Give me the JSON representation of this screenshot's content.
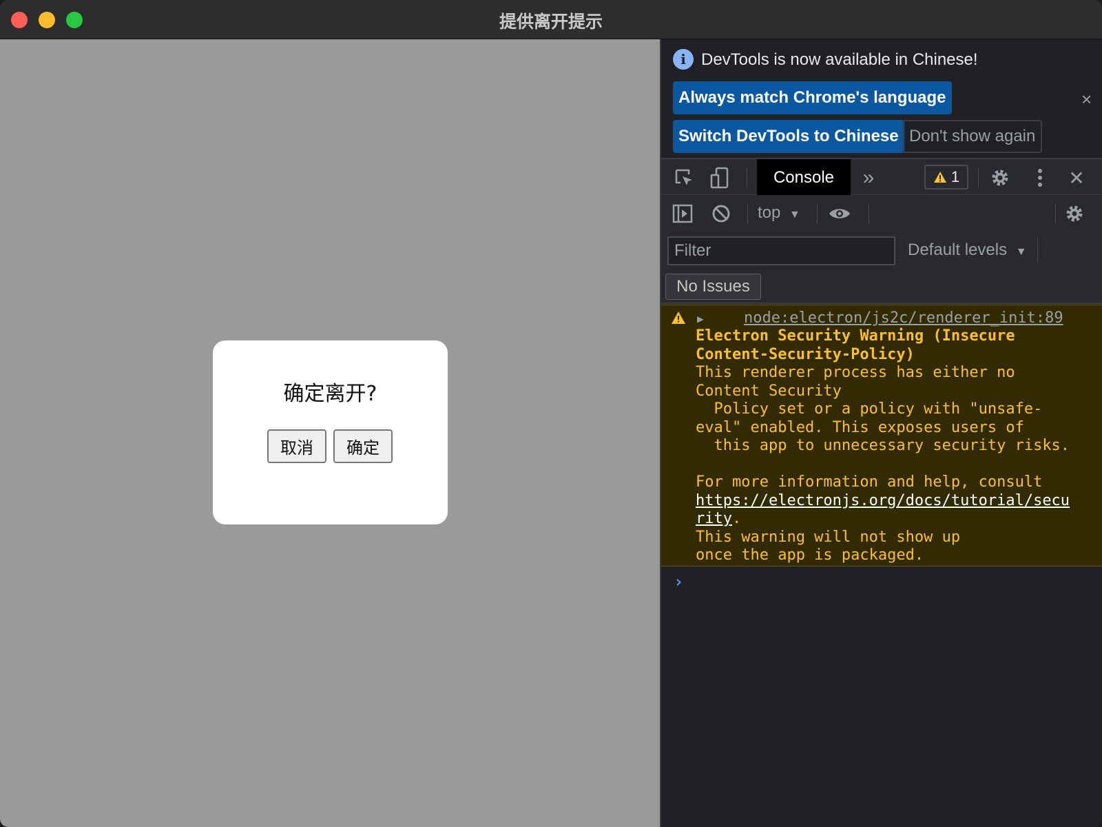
{
  "window": {
    "title": "提供离开提示",
    "traffic_lights": {
      "close": "#fe5f57",
      "minimize": "#febc2e",
      "maximize": "#28c840"
    }
  },
  "app": {
    "dialog": {
      "title": "确定离开?",
      "cancel_label": "取消",
      "confirm_label": "确定"
    }
  },
  "devtools": {
    "infobar": {
      "icon": "info-icon",
      "message": "DevTools is now available in Chinese!",
      "match_language_label": "Always match Chrome's language",
      "switch_label": "Switch DevTools to Chinese",
      "dont_show_label": "Don't show again",
      "close_glyph": "×"
    },
    "toolbar": {
      "tab_console": "Console",
      "more_tabs_glyph": "»",
      "warning_count": "1",
      "close_glyph": "✕"
    },
    "console_toolbar": {
      "context": "top",
      "filter_placeholder": "Filter",
      "levels": "Default levels",
      "issues": "No Issues"
    },
    "messages": [
      {
        "level": "warning",
        "source": "node:electron/js2c/renderer_init:89",
        "title_line1": "Electron Security Warning (Insecure",
        "title_line2": "Content-Security-Policy)",
        "body_line1": "This renderer process has either no",
        "body_line2": "Content Security",
        "body_line3": "  Policy set or a policy with \"unsafe-",
        "body_line4": "eval\" enabled. This exposes users of",
        "body_line5": "  this app to unnecessary security risks.",
        "help_line": "For more information and help, consult",
        "link_line1": "https://electronjs.org/docs/tutorial/secu",
        "link_line2": "rity",
        "link_suffix": ".",
        "footer_line1": "This warning will not show up",
        "footer_line2": "once the app is packaged."
      }
    ],
    "prompt_glyph": "›"
  }
}
